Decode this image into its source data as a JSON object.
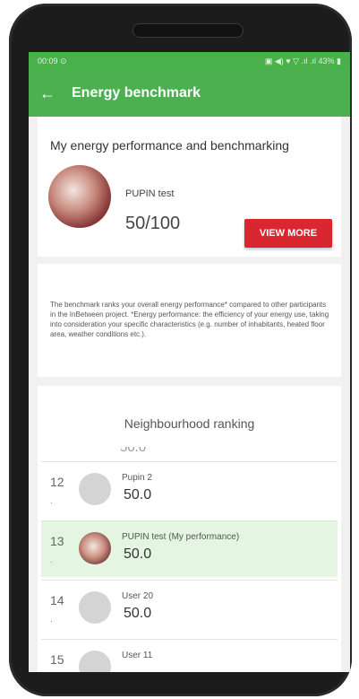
{
  "status_bar": {
    "time": "00:09 ⊙",
    "icons": "▣ ◀) ♥ ▽ .ıl .ıl 43% ▮"
  },
  "app_bar": {
    "back_icon": "←",
    "title": "Energy benchmark"
  },
  "performance": {
    "title": "My energy performance and benchmarking",
    "user_name": "PUPIN test",
    "score": "50/100",
    "view_more_label": "VIEW MORE"
  },
  "info": {
    "text": "The benchmark ranks your overall energy performance* compared to other participants in the InBetween project. *Energy performance: the efficiency of your energy use, taking into consideration your specific characteristics (e.g. number of inhabitants, heated floor area, weather conditions etc.)."
  },
  "ranking": {
    "title": "Neighbourhood ranking",
    "partial_top": "50.0",
    "rows": [
      {
        "rank": "12",
        "dot": ".",
        "name": "Pupin 2",
        "score": "50.0"
      },
      {
        "rank": "13",
        "dot": ".",
        "name": "PUPIN test (My performance)",
        "score": "50.0"
      },
      {
        "rank": "14",
        "dot": ".",
        "name": "User 20",
        "score": "50.0"
      },
      {
        "rank": "15",
        "dot": ".",
        "name": "User 11",
        "score": ""
      }
    ]
  },
  "colors": {
    "appbar": "#4caf50",
    "button": "#d9262f",
    "highlight": "#e4f6e1"
  }
}
